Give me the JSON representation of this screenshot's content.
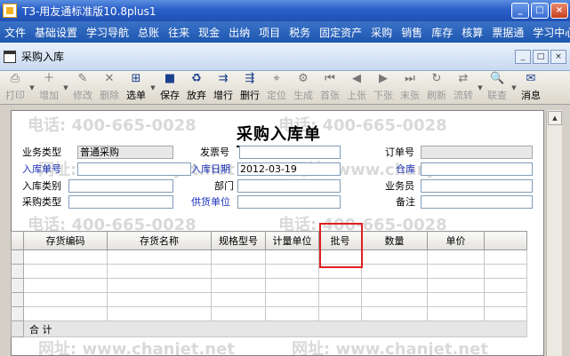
{
  "window": {
    "title": "T3-用友通标准版10.8plus1",
    "minimize": "_",
    "maximize": "□",
    "close": "×"
  },
  "menu": [
    "文件",
    "基础设置",
    "学习导航",
    "总账",
    "往来",
    "现金",
    "出纳",
    "项目",
    "税务",
    "固定资产",
    "采购",
    "销售",
    "库存",
    "核算",
    "票据通",
    "学习中心"
  ],
  "doc": {
    "title": "采购入库",
    "min": "_",
    "max": "□",
    "close": "×"
  },
  "toolbar": [
    {
      "label": "打印",
      "icon": "printer-icon",
      "glyph": "⎙",
      "enabled": false,
      "arrow": true
    },
    {
      "label": "增加",
      "icon": "add-icon",
      "glyph": "＋",
      "enabled": false,
      "arrow": true
    },
    {
      "label": "修改",
      "icon": "edit-icon",
      "glyph": "✎",
      "enabled": false
    },
    {
      "label": "删除",
      "icon": "delete-icon",
      "glyph": "✕",
      "enabled": false
    },
    {
      "label": "选单",
      "icon": "select-icon",
      "glyph": "⊞",
      "enabled": true,
      "arrow": true
    },
    {
      "label": "保存",
      "icon": "save-icon",
      "glyph": "■",
      "enabled": true
    },
    {
      "label": "放弃",
      "icon": "discard-icon",
      "glyph": "♻",
      "enabled": true
    },
    {
      "label": "增行",
      "icon": "add-row-icon",
      "glyph": "⇉",
      "enabled": true
    },
    {
      "label": "删行",
      "icon": "delete-row-icon",
      "glyph": "⇶",
      "enabled": true
    },
    {
      "label": "定位",
      "icon": "locate-icon",
      "glyph": "⌖",
      "enabled": false
    },
    {
      "label": "生成",
      "icon": "generate-icon",
      "glyph": "⚙",
      "enabled": false
    },
    {
      "label": "首张",
      "icon": "first-icon",
      "glyph": "⏮",
      "enabled": false
    },
    {
      "label": "上张",
      "icon": "prev-icon",
      "glyph": "◀",
      "enabled": false
    },
    {
      "label": "下张",
      "icon": "next-icon",
      "glyph": "▶",
      "enabled": false
    },
    {
      "label": "末张",
      "icon": "last-icon",
      "glyph": "⏭",
      "enabled": false
    },
    {
      "label": "刷新",
      "icon": "refresh-icon",
      "glyph": "↻",
      "enabled": false
    },
    {
      "label": "流转",
      "icon": "flow-icon",
      "glyph": "⇄",
      "enabled": false,
      "arrow": true
    },
    {
      "label": "联查",
      "icon": "query-icon",
      "glyph": "🔍",
      "enabled": false,
      "arrow": true
    },
    {
      "label": "消息",
      "icon": "message-icon",
      "glyph": "✉",
      "enabled": true
    }
  ],
  "form": {
    "title": "采购入库单",
    "watermark_phone": "电话: 400-665-0028",
    "watermark_site": "网址: www.chanjet.net",
    "fields": {
      "biz_type": {
        "label": "业务类型",
        "value": "普通采购"
      },
      "invoice_no": {
        "label": "发票号",
        "value": ""
      },
      "order_no": {
        "label": "订单号",
        "value": ""
      },
      "receipt_no": {
        "label": "入库单号",
        "value": ""
      },
      "receipt_date": {
        "label": "入库日期",
        "value": "2012-03-19"
      },
      "warehouse": {
        "label": "仓库",
        "value": ""
      },
      "receipt_type": {
        "label": "入库类别",
        "value": ""
      },
      "department": {
        "label": "部门",
        "value": ""
      },
      "clerk": {
        "label": "业务员",
        "value": ""
      },
      "purchase_type": {
        "label": "采购类型",
        "value": ""
      },
      "supplier": {
        "label": "供货单位",
        "value": ""
      },
      "remark": {
        "label": "备注",
        "value": ""
      }
    },
    "grid": {
      "columns": [
        "存货编码",
        "存货名称",
        "规格型号",
        "计量单位",
        "批号",
        "数量",
        "单价"
      ],
      "total_label": "合 计"
    }
  }
}
